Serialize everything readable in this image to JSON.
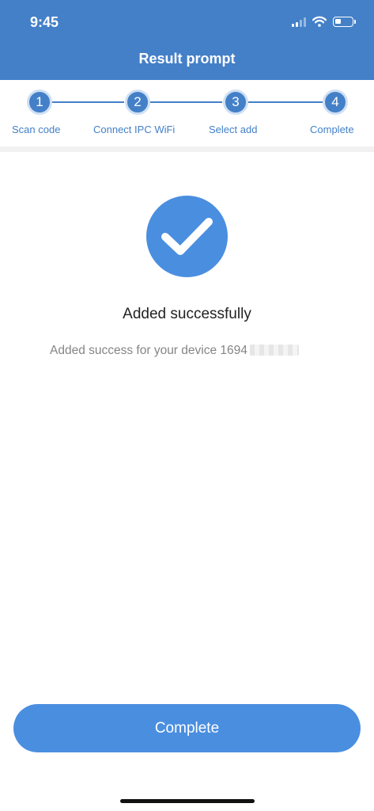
{
  "status_bar": {
    "time": "9:45",
    "icons": [
      "signal-icon",
      "wifi-icon",
      "battery-icon"
    ]
  },
  "header": {
    "title": "Result prompt"
  },
  "steps": [
    {
      "number": "1",
      "label": "Scan code"
    },
    {
      "number": "2",
      "label": "Connect IPC WiFi"
    },
    {
      "number": "3",
      "label": "Select add"
    },
    {
      "number": "4",
      "label": "Complete"
    }
  ],
  "result": {
    "icon": "checkmark-icon",
    "title": "Added successfully",
    "description": "Added success for your device 1694"
  },
  "complete_button": {
    "label": "Complete"
  },
  "colors": {
    "header_bg": "#4480c8",
    "accent": "#4a8ee0",
    "step_ring": "#cfe0f4",
    "text_dark": "#222222",
    "text_muted": "#858585"
  }
}
